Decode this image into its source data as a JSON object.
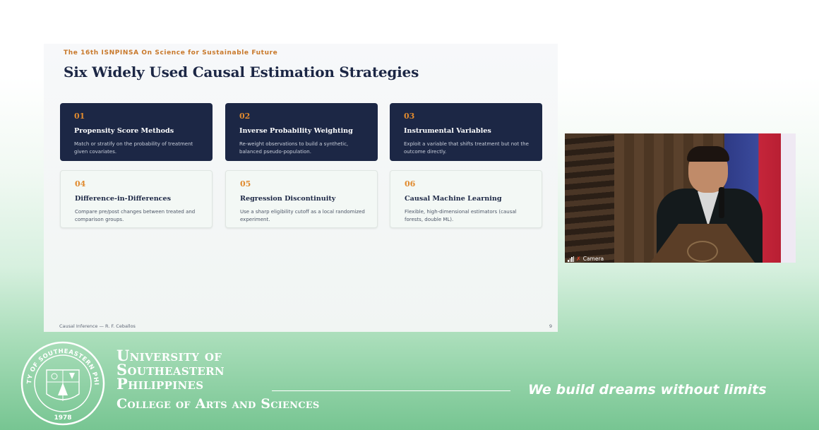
{
  "slide": {
    "conference_title": "The 16th ISNPINSA On Science for Sustainable Future",
    "title": "Six Widely Used Causal Estimation Strategies",
    "cards": [
      {
        "number": "01",
        "name": "Propensity Score Methods",
        "description": "Match or stratify on the probability of treatment given covariates.",
        "theme": "dark"
      },
      {
        "number": "02",
        "name": "Inverse Probability Weighting",
        "description": "Re-weight observations to build a synthetic, balanced pseudo-population.",
        "theme": "dark"
      },
      {
        "number": "03",
        "name": "Instrumental Variables",
        "description": "Exploit a variable that shifts treatment but not the outcome directly.",
        "theme": "dark"
      },
      {
        "number": "04",
        "name": "Difference-in-Differences",
        "description": "Compare pre/post changes between treated and comparison groups.",
        "theme": "light"
      },
      {
        "number": "05",
        "name": "Regression Discontinuity",
        "description": "Use a sharp eligibility cutoff as a local randomized experiment.",
        "theme": "light"
      },
      {
        "number": "06",
        "name": "Causal Machine Learning",
        "description": "Flexible, high-dimensional estimators (causal forests, double ML).",
        "theme": "light"
      }
    ],
    "footer_left": "Causal Inference — R. F. Ceballos",
    "page_number": "9"
  },
  "camera": {
    "label": "Camera",
    "signal_icon": "signal-bars-icon",
    "mic_icon": "mic-off-icon"
  },
  "branding": {
    "university_lines": [
      "University of",
      "Southeastern",
      "Philippines"
    ],
    "college": "College of Arts and Sciences",
    "tagline": "We build dreams without limits",
    "seal_year": "1978",
    "seal_text": "UNIVERSITY OF SOUTHEASTERN PHILIPPINES"
  },
  "colors": {
    "navy": "#1c2745",
    "orange": "#e08a2e",
    "green": "#77c592"
  }
}
